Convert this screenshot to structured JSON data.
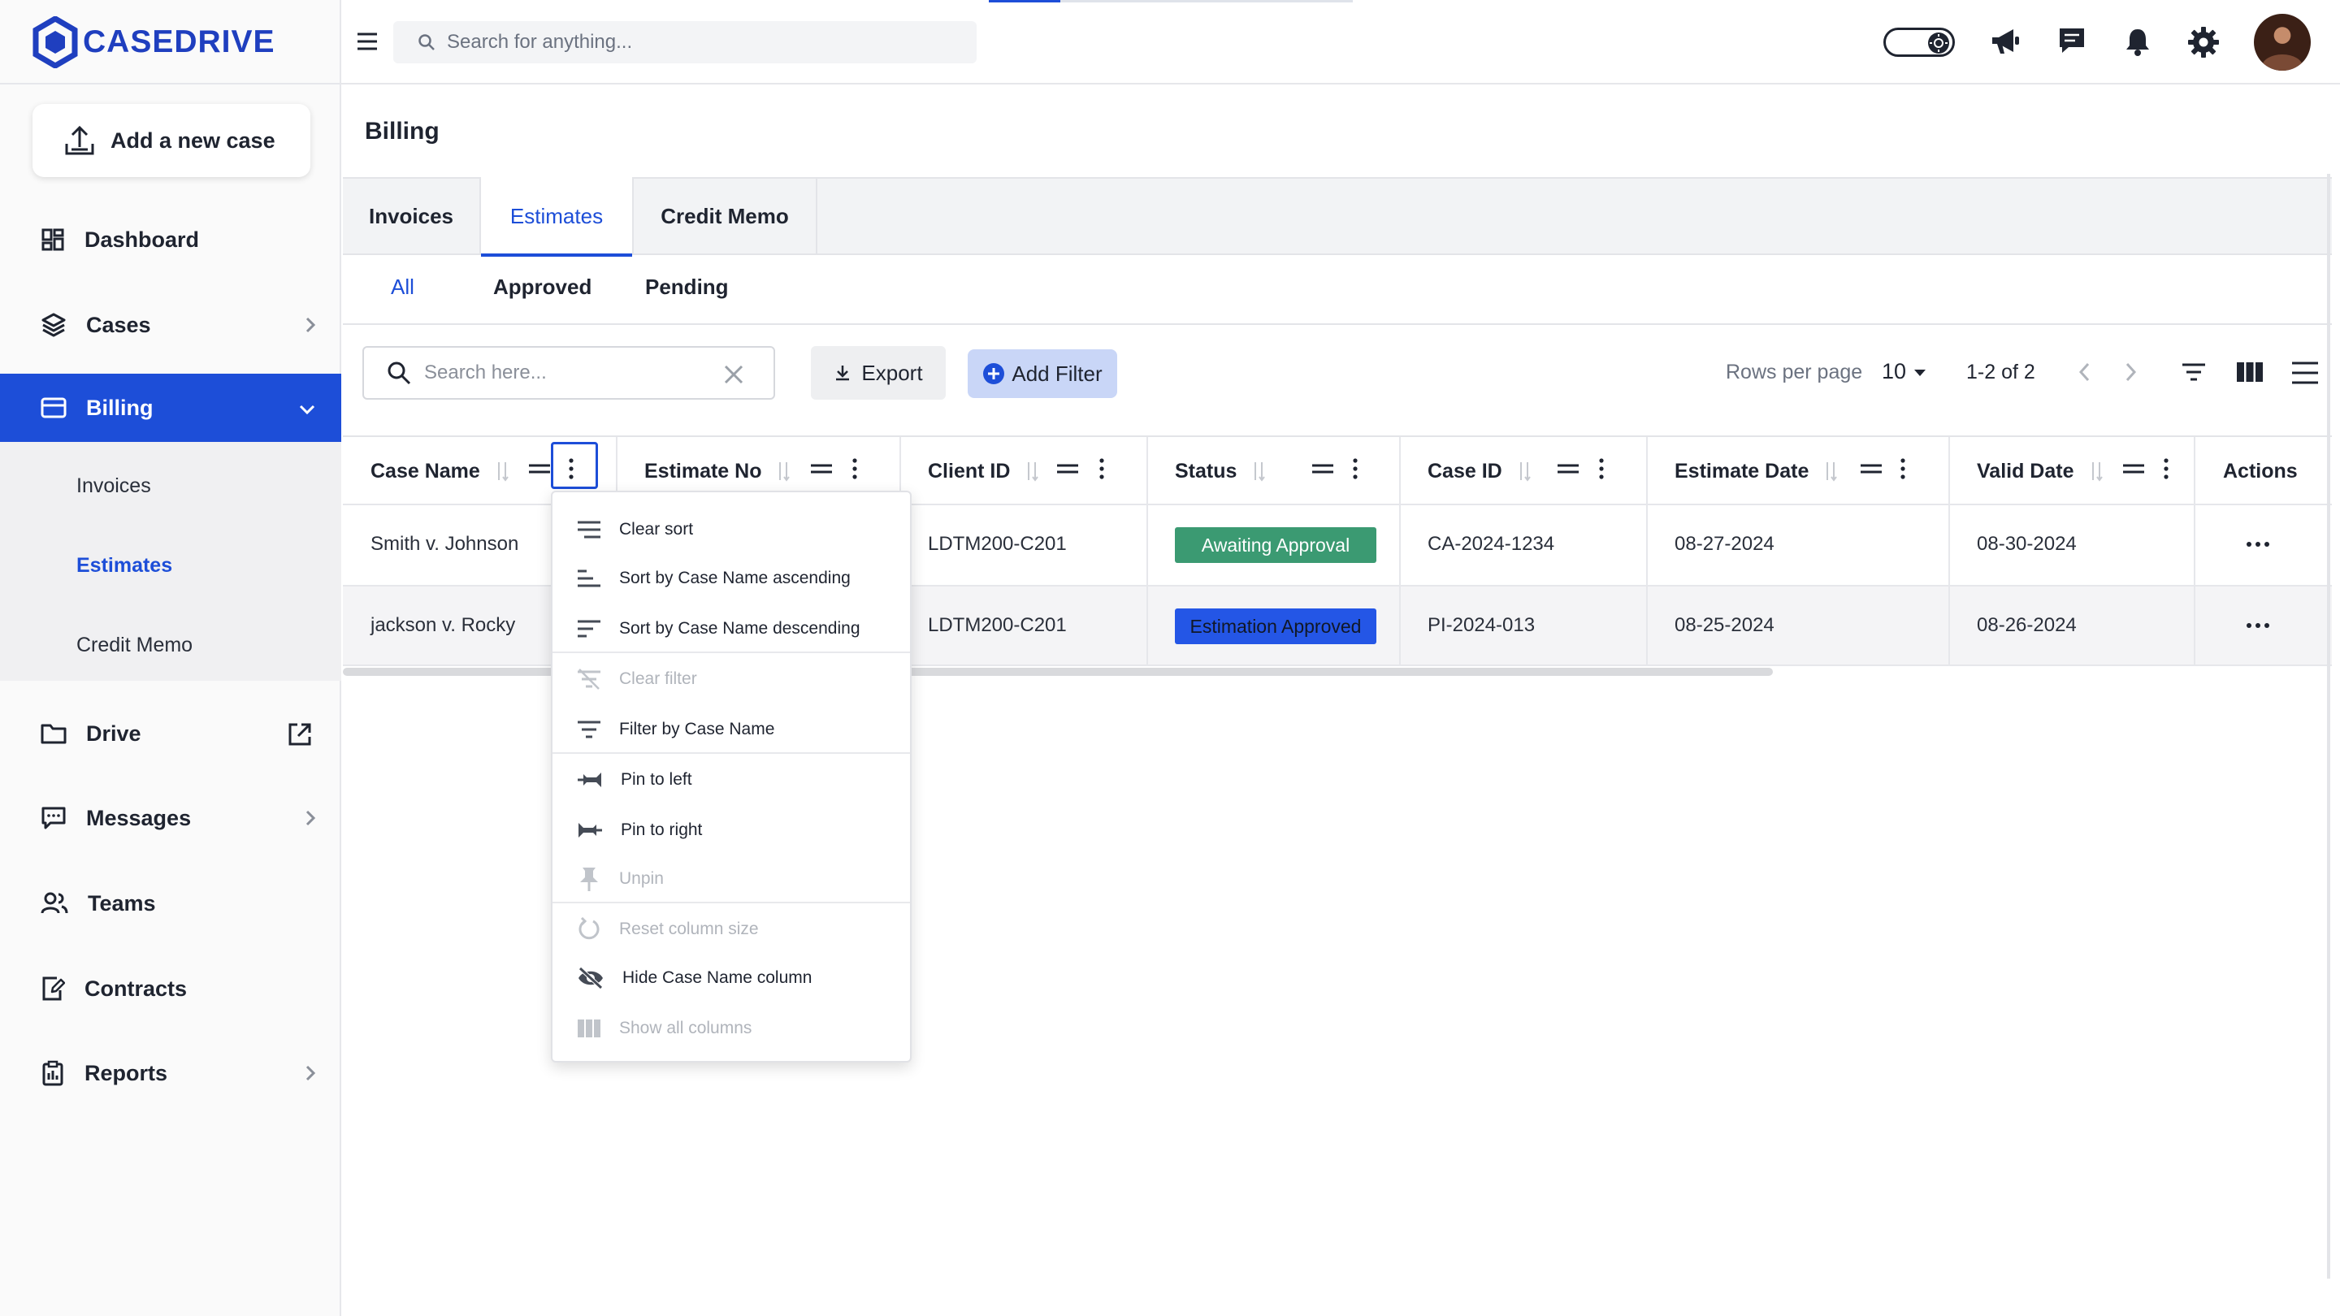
{
  "app": {
    "brand": "CASEDRIVE"
  },
  "sidebar": {
    "add_case_label": "Add a new case",
    "items": [
      {
        "label": "Dashboard"
      },
      {
        "label": "Cases"
      },
      {
        "label": "Billing"
      },
      {
        "label": "Drive"
      },
      {
        "label": "Messages"
      },
      {
        "label": "Teams"
      },
      {
        "label": "Contracts"
      },
      {
        "label": "Reports"
      }
    ],
    "billing_sub": [
      "Invoices",
      "Estimates",
      "Credit Memo"
    ]
  },
  "topbar": {
    "search_placeholder": "Search for anything..."
  },
  "page": {
    "title": "Billing",
    "tabs": [
      "Invoices",
      "Estimates",
      "Credit Memo"
    ],
    "subtabs": [
      "All",
      "Approved",
      "Pending"
    ]
  },
  "toolbar": {
    "search_placeholder": "Search here...",
    "export_label": "Export",
    "add_filter_label": "Add Filter",
    "rows_per_page_label": "Rows per page",
    "rows_per_page_value": "10",
    "page_range": "1-2 of 2"
  },
  "table": {
    "columns": [
      "Case Name",
      "Estimate No",
      "Client ID",
      "Status",
      "Case ID",
      "Estimate Date",
      "Valid Date",
      "Actions"
    ],
    "rows": [
      {
        "case_name": "Smith v. Johnson",
        "client_id": "LDTM200-C201",
        "status": "Awaiting Approval",
        "case_id": "CA-2024-1234",
        "estimate_date": "08-27-2024",
        "valid_date": "08-30-2024"
      },
      {
        "case_name": "jackson v. Rocky",
        "client_id": "LDTM200-C201",
        "status": "Estimation Approved",
        "case_id": "PI-2024-013",
        "estimate_date": "08-25-2024",
        "valid_date": "08-26-2024"
      }
    ],
    "status_colors": {
      "Awaiting Approval": "#3b9a72",
      "Estimation Approved": "#2456e6"
    }
  },
  "column_menu": {
    "items": [
      {
        "label": "Clear sort",
        "disabled": false
      },
      {
        "label": "Sort by Case Name ascending",
        "disabled": false
      },
      {
        "label": "Sort by Case Name descending",
        "disabled": false
      },
      {
        "label": "Clear filter",
        "disabled": true
      },
      {
        "label": "Filter by Case Name",
        "disabled": false
      },
      {
        "label": "Pin to left",
        "disabled": false
      },
      {
        "label": "Pin to right",
        "disabled": false
      },
      {
        "label": "Unpin",
        "disabled": true
      },
      {
        "label": "Reset column size",
        "disabled": true
      },
      {
        "label": "Hide Case Name column",
        "disabled": false
      },
      {
        "label": "Show all columns",
        "disabled": true
      }
    ]
  },
  "colors": {
    "accent": "#1d4ed8",
    "brand": "#1f3fbf"
  }
}
